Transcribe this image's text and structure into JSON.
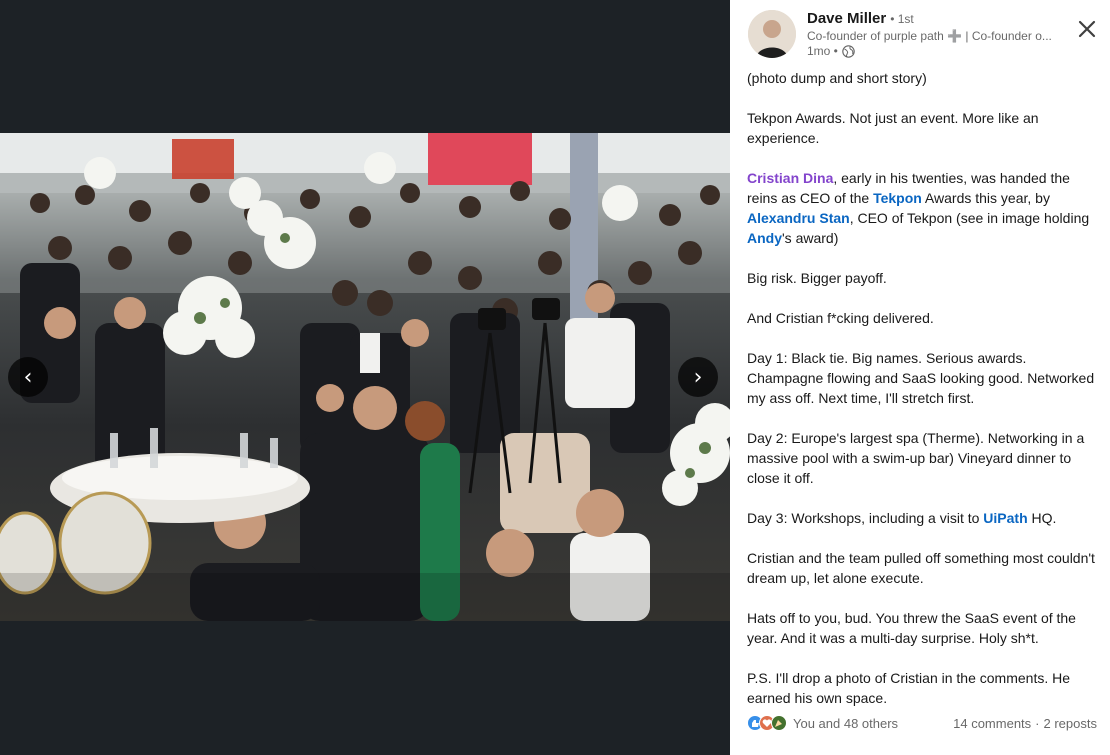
{
  "author": {
    "name": "Dave Miller",
    "degree": "• 1st",
    "headline": "Co-founder of purple path ➕ | Co-founder o...",
    "time": "1mo •"
  },
  "post": {
    "p1": "(photo dump and short story)",
    "p2": "Tekpon Awards. Not just an event. More like an experience.",
    "p3_mention1": "Cristian Dina",
    "p3_a": ", early in his twenties, was handed the reins as CEO of the ",
    "p3_link1": "Tekpon",
    "p3_b": " Awards this year, by ",
    "p3_link2": "Alexandru Stan",
    "p3_c": ", CEO of Tekpon (see in image holding ",
    "p3_link3": "Andy",
    "p3_d": "'s award)",
    "p4": "Big risk. Bigger payoff.",
    "p5": "And Cristian f*cking delivered.",
    "p6": "Day 1: Black tie. Big names. Serious awards. Champagne flowing and SaaS looking good. Networked my ass off. Next time, I'll stretch first.",
    "p7": "Day 2: Europe's largest spa (Therme). Networking in a massive pool with a swim-up bar) Vineyard dinner to close it off.",
    "p8_a": "Day 3: Workshops, including a visit to ",
    "p8_link": "UiPath",
    "p8_b": " HQ.",
    "p9": "Cristian and the team pulled off something most couldn't dream up, let alone execute.",
    "p10": "Hats off to you, bud. You threw the SaaS event of the year. And it was a multi-day surprise. Holy sh*t.",
    "p11": "P.S. I'll drop a photo of Cristian in the comments. He earned his own space."
  },
  "social": {
    "reactions_text": "You and 48 others",
    "comments": "14 comments",
    "separator": "·",
    "reposts": "2 reposts"
  },
  "nav": {
    "prev": "‹",
    "next": "›"
  },
  "colors": {
    "mention": "#8344cc",
    "link": "#0a66c2",
    "backdrop": "#1d2226"
  }
}
